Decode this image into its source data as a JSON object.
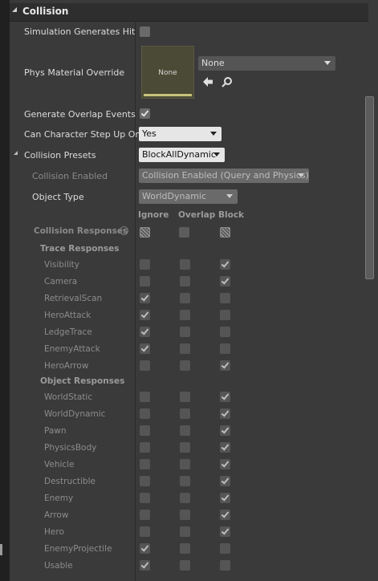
{
  "section_title": "Collision",
  "sim_hit_events": {
    "label": "Simulation Generates Hit Ev",
    "checked": false
  },
  "phys_material": {
    "label": "Phys Material Override",
    "thumb_label": "None",
    "value": "None"
  },
  "overlap_events": {
    "label": "Generate Overlap Events",
    "checked": true
  },
  "step_up": {
    "label": "Can Character Step Up On",
    "value": "Yes"
  },
  "presets": {
    "label": "Collision Presets",
    "value": "BlockAllDynamic"
  },
  "collision_enabled": {
    "label": "Collision Enabled",
    "value": "Collision Enabled (Query and Physics)"
  },
  "object_type": {
    "label": "Object Type",
    "value": "WorldDynamic"
  },
  "columns": {
    "ignore": "Ignore",
    "overlap": "Overlap",
    "block": "Block"
  },
  "collision_responses": {
    "label": "Collision Responses",
    "help": "?"
  },
  "trace_responses": {
    "title": "Trace Responses",
    "items": [
      {
        "label": "Visibility",
        "response": "block"
      },
      {
        "label": "Camera",
        "response": "block"
      },
      {
        "label": "RetrievalScan",
        "response": "ignore"
      },
      {
        "label": "HeroAttack",
        "response": "ignore"
      },
      {
        "label": "LedgeTrace",
        "response": "ignore"
      },
      {
        "label": "EnemyAttack",
        "response": "ignore"
      },
      {
        "label": "HeroArrow",
        "response": "block"
      }
    ]
  },
  "object_responses": {
    "title": "Object Responses",
    "items": [
      {
        "label": "WorldStatic",
        "response": "block"
      },
      {
        "label": "WorldDynamic",
        "response": "block"
      },
      {
        "label": "Pawn",
        "response": "block"
      },
      {
        "label": "PhysicsBody",
        "response": "block"
      },
      {
        "label": "Vehicle",
        "response": "block"
      },
      {
        "label": "Destructible",
        "response": "block"
      },
      {
        "label": "Enemy",
        "response": "block"
      },
      {
        "label": "Arrow",
        "response": "block"
      },
      {
        "label": "Hero",
        "response": "block"
      },
      {
        "label": "EnemyProjectile",
        "response": "ignore"
      },
      {
        "label": "Usable",
        "response": "ignore"
      }
    ]
  },
  "colors": {
    "panel": "#3a3a3a",
    "header": "#2e2e2e",
    "checkbox": "#5c5c5c",
    "dropdown_light": "#e6e6e6"
  },
  "icons": {
    "use_selected": "arrow-left-icon",
    "browse": "magnifier-icon"
  }
}
